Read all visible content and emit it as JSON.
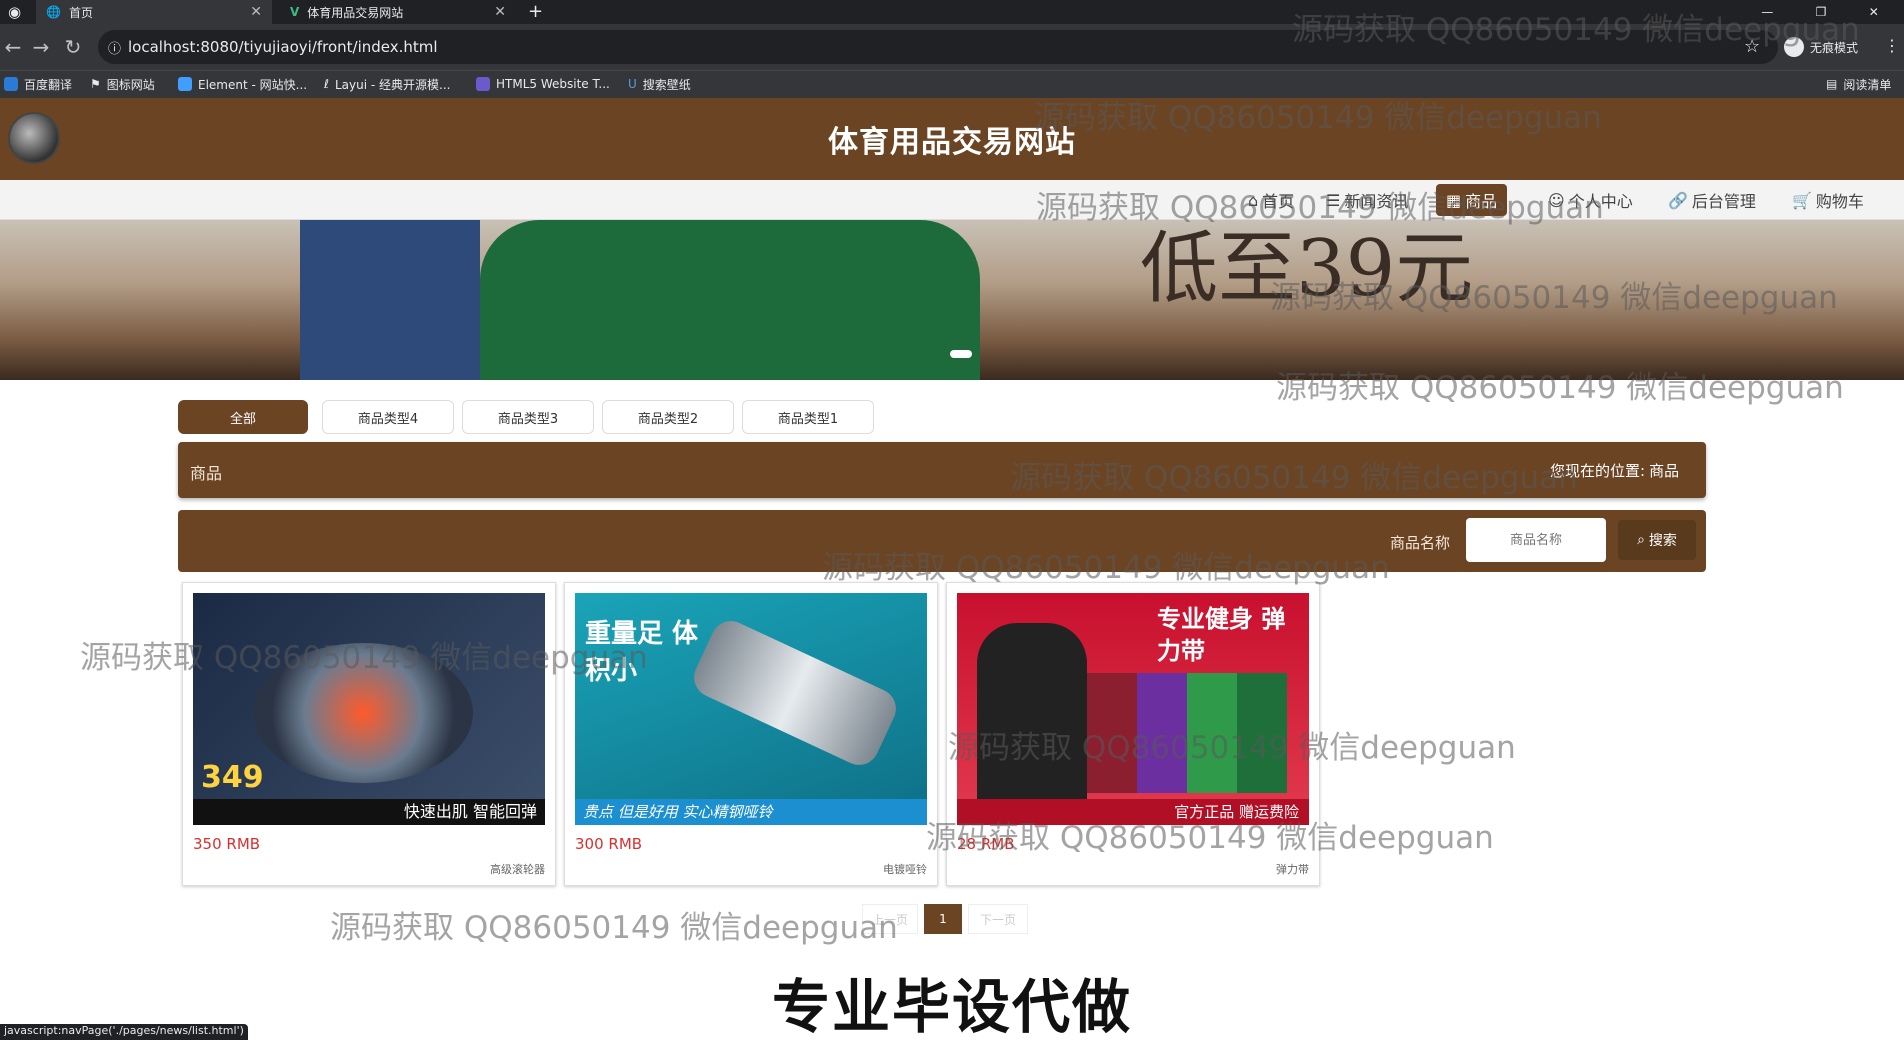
{
  "browser": {
    "tabs": [
      {
        "label": "首页",
        "active": true
      },
      {
        "label": "体育用品交易网站",
        "active": false
      }
    ],
    "url": "localhost:8080/tiyujiaoyi/front/index.html",
    "incognito_label": "无痕模式",
    "bookmarks": [
      "百度翻译",
      "图标网站",
      "Element - 网站快...",
      "Layui - 经典开源模...",
      "HTML5 Website T...",
      "搜索壁纸"
    ],
    "reading_list": "阅读清单",
    "status_url": "javascript:navPage('./pages/news/list.html')"
  },
  "site": {
    "title": "体育用品交易网站",
    "nav": [
      {
        "label": "首页",
        "icon": "home-icon"
      },
      {
        "label": "新闻资讯",
        "icon": "news-icon"
      },
      {
        "label": "商品",
        "icon": "goods-icon",
        "active": true
      },
      {
        "label": "个人中心",
        "icon": "user-icon"
      },
      {
        "label": "后台管理",
        "icon": "link-icon"
      },
      {
        "label": "购物车",
        "icon": "cart-icon"
      }
    ],
    "banner_text": "低至39元"
  },
  "categories": [
    "全部",
    "商品类型4",
    "商品类型3",
    "商品类型2",
    "商品类型1"
  ],
  "section": {
    "title": "商品",
    "breadcrumb_prefix": "您现在的位置:",
    "breadcrumb_current": "商品"
  },
  "search": {
    "label": "商品名称",
    "placeholder": "商品名称",
    "button": "搜索"
  },
  "products": [
    {
      "price": "350 RMB",
      "name": "高级滚轮器",
      "img_text": "349",
      "img_caption": "快速出肌 智能回弹",
      "colors": [
        "#1b2a44",
        "#ff5a2a"
      ]
    },
    {
      "price": "300 RMB",
      "name": "电镀哑铃",
      "img_text": "重量足 体积小",
      "img_caption": "贵点 但是好用 实心精钢哑铃",
      "colors": [
        "#1aa4b8",
        "#bfc7cc"
      ]
    },
    {
      "price": "28 RMB",
      "name": "弹力带",
      "img_text": "专业健身 弹力带",
      "img_caption": "官方正品 赠运费险",
      "colors": [
        "#c8102e",
        "#2f9a4a"
      ]
    }
  ],
  "pager": {
    "prev": "上一页",
    "current": "1",
    "next": "下一页"
  },
  "overlay": {
    "watermark": "源码获取 QQ86050149 微信deepguan",
    "bottom_text": "专业毕设代做"
  }
}
